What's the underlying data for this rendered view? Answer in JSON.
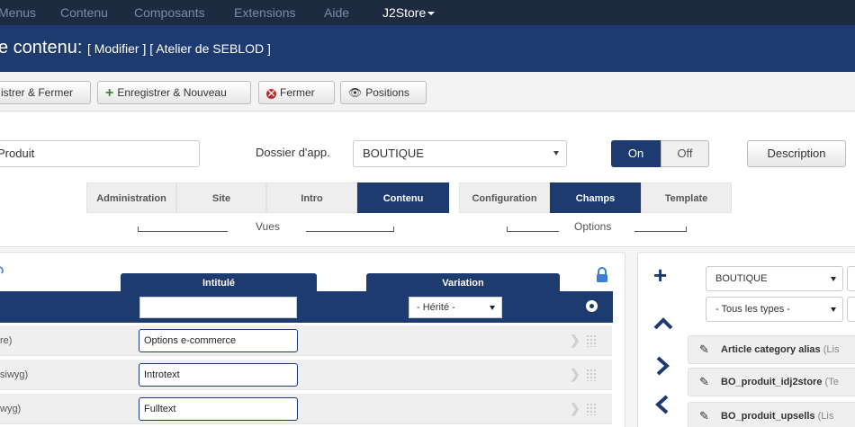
{
  "topnav": {
    "items": [
      "Menus",
      "Contenu",
      "Composants",
      "Extensions",
      "Aide"
    ],
    "active": "J2Store"
  },
  "titlebar": {
    "title": "e contenu:",
    "subtitle": "[ Modifier ] [ Atelier de SEBLOD ]"
  },
  "toolbar": {
    "save_close": "istrer & Fermer",
    "save_new": "Enregistrer & Nouveau",
    "close": "Fermer",
    "positions": "Positions"
  },
  "form": {
    "name_value": "Produit",
    "folder_label": "Dossier d'app.",
    "folder_value": "BOUTIQUE",
    "toggle_on": "On",
    "toggle_off": "Off",
    "description": "Description",
    "views_tabs": [
      "Administration",
      "Site",
      "Intro",
      "Contenu"
    ],
    "views_active": "Contenu",
    "views_label": "Vues",
    "options_tabs": [
      "Configuration",
      "Champs",
      "Template"
    ],
    "options_active": "Champs",
    "options_label": "Options"
  },
  "fields_table": {
    "col_intitule": "Intitulé",
    "col_variation": "Variation",
    "variation_filter": "- Hérité -",
    "rows": [
      {
        "type": "re)",
        "value": "Options e-commerce"
      },
      {
        "type": "siwyg)",
        "value": "Introtext"
      },
      {
        "type": "wyg)",
        "value": "Fulltext"
      }
    ]
  },
  "right_panel": {
    "folder_filter": "BOUTIQUE",
    "type_filter": "- Tous les types -",
    "fields": [
      {
        "name": "Article category alias",
        "type": "(Lis"
      },
      {
        "name": "BO_produit_idj2store",
        "type": "(Te"
      },
      {
        "name": "BO_produit_upsells",
        "type": "(Lis"
      }
    ]
  },
  "colors": {
    "navy": "#1d3b6f",
    "topnav": "#1e2a40"
  }
}
